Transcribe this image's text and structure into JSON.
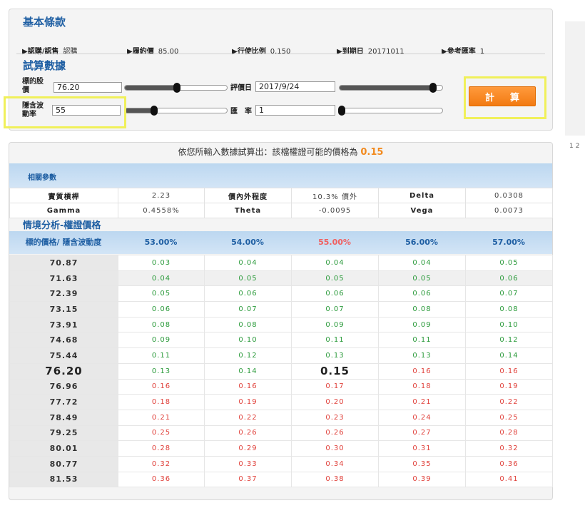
{
  "basic_terms": {
    "title": "基本條款",
    "items": [
      {
        "label": "▶認購/認售",
        "value": "認購"
      },
      {
        "label": "▶履約價",
        "value": "85.00"
      },
      {
        "label": "▶行使比例",
        "value": "0.150"
      },
      {
        "label": "▶到期日",
        "value": "20171011"
      },
      {
        "label": "▶參考匯率",
        "value": "1"
      }
    ]
  },
  "trial": {
    "title": "試算數據",
    "underlying_label_1": "標的股",
    "underlying_label_2": "價",
    "underlying_value": "76.20",
    "eval_date_label": "評價日",
    "eval_date_value": "2017/9/24",
    "volatility_label_1": "隱含波",
    "volatility_label_2": "動率",
    "volatility_value": "55",
    "fx_label": "匯　率",
    "fx_value": "1",
    "calc_button": "計算",
    "sliders": {
      "underlying_level": 0.51,
      "eval_date_level": 0.91,
      "volatility_level": 0.29,
      "fx_level": 0.02
    }
  },
  "pager": [
    "1",
    "2"
  ],
  "result": {
    "prefix": "依您所輸入數據試算出：該檔權證可能的價格為",
    "price": "0.15"
  },
  "params": {
    "title": "相關參數",
    "rows": [
      [
        "實質槓桿",
        "2.23",
        "價內外程度",
        "10.3% 價外",
        "Delta",
        "0.0308"
      ],
      [
        "Gamma",
        "0.4558%",
        "Theta",
        "-0.0095",
        "Vega",
        "0.0073"
      ]
    ]
  },
  "scenario": {
    "title": "情境分析-權證價格",
    "corner_label": "標的價格/ 隱含波動度",
    "vol_headers": [
      "53.00%",
      "54.00%",
      "55.00%",
      "56.00%",
      "57.00%"
    ],
    "current_vol_index": 2,
    "current_price_index": 7,
    "rows": [
      {
        "price": "70.87",
        "values": [
          "0.03",
          "0.04",
          "0.04",
          "0.04",
          "0.05"
        ]
      },
      {
        "price": "71.63",
        "values": [
          "0.04",
          "0.05",
          "0.05",
          "0.05",
          "0.06"
        ]
      },
      {
        "price": "72.39",
        "values": [
          "0.05",
          "0.06",
          "0.06",
          "0.06",
          "0.07"
        ]
      },
      {
        "price": "73.15",
        "values": [
          "0.06",
          "0.07",
          "0.07",
          "0.08",
          "0.08"
        ]
      },
      {
        "price": "73.91",
        "values": [
          "0.08",
          "0.08",
          "0.09",
          "0.09",
          "0.10"
        ]
      },
      {
        "price": "74.68",
        "values": [
          "0.09",
          "0.10",
          "0.11",
          "0.11",
          "0.12"
        ]
      },
      {
        "price": "75.44",
        "values": [
          "0.11",
          "0.12",
          "0.13",
          "0.13",
          "0.14"
        ]
      },
      {
        "price": "76.20",
        "values": [
          "0.13",
          "0.14",
          "0.15",
          "0.16",
          "0.16"
        ]
      },
      {
        "price": "76.96",
        "values": [
          "0.16",
          "0.16",
          "0.17",
          "0.18",
          "0.19"
        ]
      },
      {
        "price": "77.72",
        "values": [
          "0.18",
          "0.19",
          "0.20",
          "0.21",
          "0.22"
        ]
      },
      {
        "price": "78.49",
        "values": [
          "0.21",
          "0.22",
          "0.23",
          "0.24",
          "0.25"
        ]
      },
      {
        "price": "79.25",
        "values": [
          "0.25",
          "0.26",
          "0.26",
          "0.27",
          "0.28"
        ]
      },
      {
        "price": "80.01",
        "values": [
          "0.28",
          "0.29",
          "0.30",
          "0.31",
          "0.32"
        ]
      },
      {
        "price": "80.77",
        "values": [
          "0.32",
          "0.33",
          "0.34",
          "0.35",
          "0.36"
        ]
      },
      {
        "price": "81.53",
        "values": [
          "0.36",
          "0.37",
          "0.38",
          "0.39",
          "0.41"
        ]
      }
    ]
  },
  "colors": {
    "accent_blue": "#1f5fa3",
    "button_orange": "#f27a12",
    "up_green": "#2a9a3a",
    "down_red": "#e0403a",
    "highlight_yellow": "#f0f05a"
  }
}
